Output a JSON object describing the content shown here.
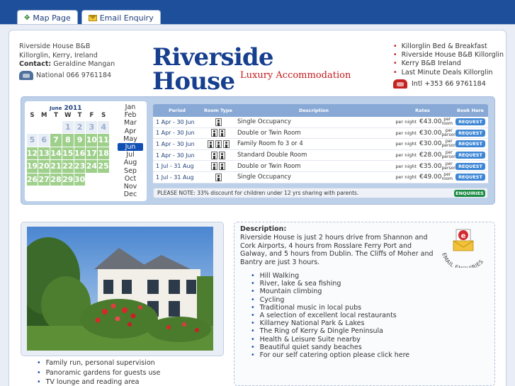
{
  "tabs": [
    {
      "label": "Map Page",
      "icon": "map-icon"
    },
    {
      "label": "Email Enquiry",
      "icon": "envelope-icon"
    }
  ],
  "header": {
    "address_line1": "Riverside House B&B",
    "address_line2": "Killorglin, Kerry, Ireland",
    "contact_label": "Contact:",
    "contact_name": "Geraldine Mangan",
    "national_phone": "National 066 9761184",
    "logo_title": "Riverside House",
    "logo_subtitle": "Luxury Accommodation",
    "links": [
      "Killorglin Bed & Breakfast",
      "Riverside House B&B Killorglin",
      "Kerry B&B Ireland",
      "Last Minute Deals Killorglin"
    ],
    "intl_phone": "Intl +353 66 9761184"
  },
  "calendar": {
    "month_label": "June",
    "year": "2011",
    "dow": [
      "S",
      "M",
      "T",
      "W",
      "T",
      "F",
      "S"
    ],
    "days": [
      {
        "d": "",
        "s": "empty"
      },
      {
        "d": "",
        "s": "empty"
      },
      {
        "d": "",
        "s": "empty"
      },
      {
        "d": "1",
        "s": "past"
      },
      {
        "d": "2",
        "s": "past"
      },
      {
        "d": "3",
        "s": "past"
      },
      {
        "d": "4",
        "s": "past"
      },
      {
        "d": "5",
        "s": "past"
      },
      {
        "d": "6",
        "s": "past"
      },
      {
        "d": "7",
        "s": "free"
      },
      {
        "d": "8",
        "s": "free"
      },
      {
        "d": "9",
        "s": "free"
      },
      {
        "d": "10",
        "s": "free"
      },
      {
        "d": "11",
        "s": "free"
      },
      {
        "d": "12",
        "s": "free"
      },
      {
        "d": "13",
        "s": "free"
      },
      {
        "d": "14",
        "s": "free"
      },
      {
        "d": "15",
        "s": "free"
      },
      {
        "d": "16",
        "s": "free"
      },
      {
        "d": "17",
        "s": "free"
      },
      {
        "d": "18",
        "s": "free"
      },
      {
        "d": "19",
        "s": "free"
      },
      {
        "d": "20",
        "s": "free"
      },
      {
        "d": "21",
        "s": "free"
      },
      {
        "d": "22",
        "s": "free"
      },
      {
        "d": "23",
        "s": "free"
      },
      {
        "d": "24",
        "s": "free"
      },
      {
        "d": "25",
        "s": "free"
      },
      {
        "d": "26",
        "s": "free"
      },
      {
        "d": "27",
        "s": "free"
      },
      {
        "d": "28",
        "s": "free"
      },
      {
        "d": "29",
        "s": "free"
      },
      {
        "d": "30",
        "s": "free"
      },
      {
        "d": "",
        "s": "empty"
      },
      {
        "d": "",
        "s": "empty"
      }
    ],
    "months": [
      "Jan",
      "Feb",
      "Mar",
      "Apr",
      "May",
      "Jun",
      "Jul",
      "Aug",
      "Sep",
      "Oct",
      "Nov",
      "Dec"
    ],
    "selected_month": "Jun"
  },
  "rates": {
    "headers": [
      "Period",
      "Room Type",
      "Description",
      "Rates",
      "",
      "Book Here"
    ],
    "rows": [
      {
        "period": "1 Apr - 30 Jun",
        "persons": 1,
        "desc": "Single Occupancy",
        "per_night": "per night",
        "price": "€43.00",
        "unit": "per room",
        "book": "REQUEST"
      },
      {
        "period": "1 Apr - 30 Jun",
        "persons": 2,
        "desc": "Double or Twin Room",
        "per_night": "per night",
        "price": "€30.00",
        "unit": "per person",
        "book": "REQUEST"
      },
      {
        "period": "1 Apr - 30 Jun",
        "persons": 3,
        "desc": "Family Room fo 3 or 4",
        "per_night": "per night",
        "price": "€30.00",
        "unit": "per person",
        "book": "REQUEST"
      },
      {
        "period": "1 Apr - 30 Jun",
        "persons": 2,
        "desc": "Standard Double Room",
        "per_night": "per night",
        "price": "€28.00",
        "unit": "per person",
        "book": "REQUEST"
      },
      {
        "period": "1 Jul - 31 Aug",
        "persons": 2,
        "desc": "Double or Twin Room",
        "per_night": "per night",
        "price": "€35.00",
        "unit": "per person",
        "book": "REQUEST"
      },
      {
        "period": "1 Jul - 31 Aug",
        "persons": 1,
        "desc": "Single Occupancy",
        "per_night": "per night",
        "price": "€49.00",
        "unit": "per room",
        "book": "REQUEST"
      }
    ],
    "note": "PLEASE NOTE: 33% discount for children under 12 yrs sharing with parents.",
    "enquiries_label": "ENQUIRIES"
  },
  "features_left": [
    "Family run, personal supervision",
    "Panoramic gardens for guests use",
    "TV lounge and reading area"
  ],
  "description": {
    "title": "Description:",
    "text": "Riverside House is just 2 hours drive from Shannon and Cork Airports, 4 hours from Rosslare Ferry Port and Galway, and 5 hours from Dublin. The Cliffs of Moher and Bantry are just 3 hours.",
    "features": [
      "Hill Walking",
      "River, lake & sea fishing",
      "Mountain climbing",
      "Cycling",
      "Traditional music in local pubs",
      "A selection of excellent local restaurants",
      "Killarney National Park & Lakes",
      "The Ring of Kerry & Dingle Peninsula",
      "Health & Leisure Suite nearby",
      "Beautiful quiet sandy beaches",
      "For our self catering option please click here"
    ],
    "email_badge": "EMAIL ENQUIRIES"
  }
}
